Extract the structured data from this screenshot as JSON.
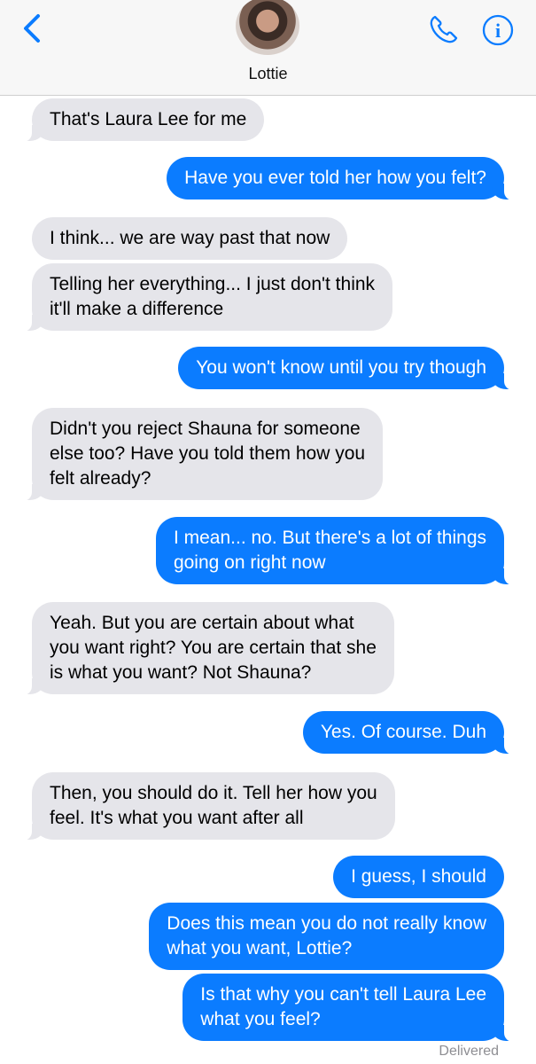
{
  "header": {
    "contact_name": "Lottie",
    "back_icon": "chevron-left-icon",
    "call_icon": "phone-icon",
    "info_icon": "info-icon",
    "accent_color": "#0b7cff"
  },
  "messages": [
    {
      "side": "in",
      "text": "That's Laura Lee for me"
    },
    {
      "side": "out",
      "text": "Have you ever told her how you felt?"
    },
    {
      "side": "in",
      "text": "I think... we are way past that now"
    },
    {
      "side": "in",
      "text": "Telling her everything... I just don't think\nit'll make a difference"
    },
    {
      "side": "out",
      "text": "You won't know until you try though"
    },
    {
      "side": "in",
      "text": "Didn't you reject Shauna for someone\nelse too? Have you told them how you\nfelt already?"
    },
    {
      "side": "out",
      "text": "I mean... no. But there's a lot of things\ngoing on right now"
    },
    {
      "side": "in",
      "text": "Yeah. But you are certain about what\nyou want right? You are certain that she\nis what you want? Not Shauna?"
    },
    {
      "side": "out",
      "text": "Yes. Of course. Duh"
    },
    {
      "side": "in",
      "text": "Then, you should do it. Tell her how you\nfeel. It's what you want after all"
    },
    {
      "side": "out",
      "text": "I guess, I should"
    },
    {
      "side": "out",
      "text": "Does this mean you do not really know\nwhat you want, Lottie?"
    },
    {
      "side": "out",
      "text": "Is that why you can't tell Laura Lee\nwhat you feel?"
    }
  ],
  "status": {
    "delivered": "Delivered"
  }
}
